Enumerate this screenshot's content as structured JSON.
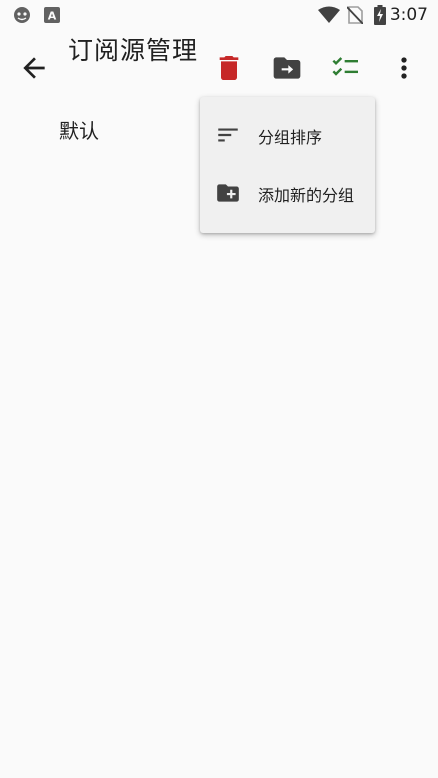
{
  "status_bar": {
    "time": "3:07",
    "icons": [
      "app-notification-icon",
      "keyboard-a-icon",
      "wifi-icon",
      "no-sim-icon",
      "battery-charging-icon"
    ]
  },
  "toolbar": {
    "title": "订阅源管理",
    "actions": [
      "back-arrow-icon",
      "delete-icon",
      "move-to-folder-icon",
      "select-all-icon",
      "more-vert-icon"
    ]
  },
  "groups": [
    {
      "label": "默认"
    }
  ],
  "menu": {
    "items": [
      {
        "label": "分组排序",
        "icon": "sort-icon"
      },
      {
        "label": "添加新的分组",
        "icon": "create-folder-icon"
      }
    ]
  },
  "colors": {
    "background": "#fafafa",
    "delete_red": "#c62828",
    "check_green": "#2e7d32",
    "menu_bg": "#f0f0f0",
    "icon_dark": "#424242"
  }
}
